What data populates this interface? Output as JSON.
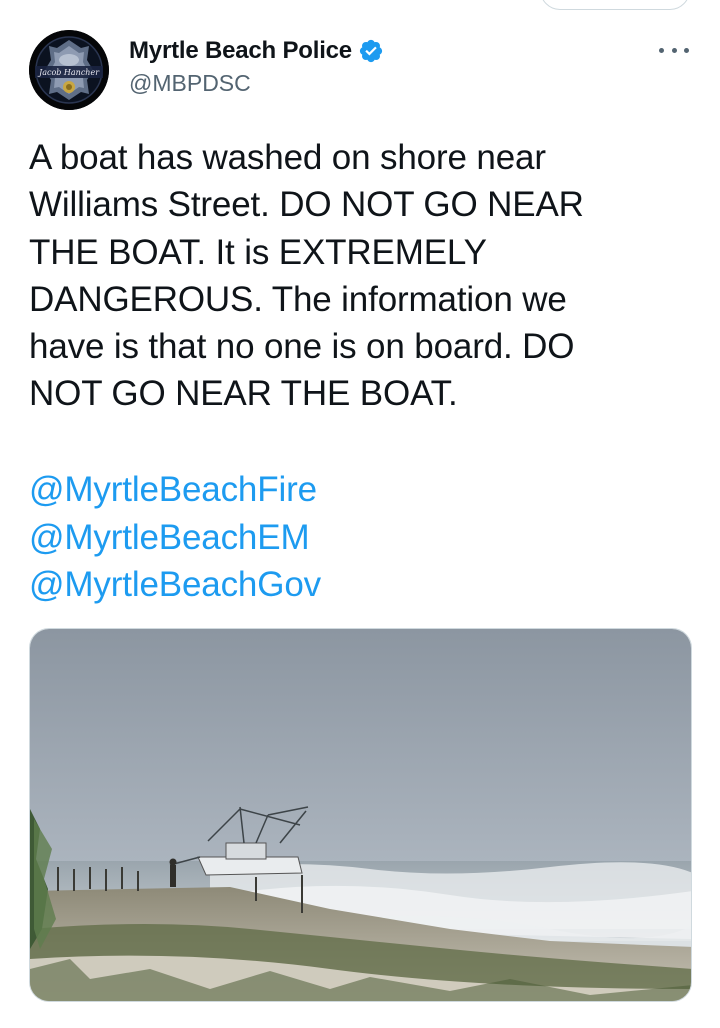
{
  "author": {
    "display_name": "Myrtle Beach Police",
    "handle": "@MBPDSC",
    "verified": true,
    "avatar_icon": "police-badge-icon"
  },
  "tweet": {
    "text": "A boat has washed on shore near\nWilliams Street. DO NOT GO NEAR\nTHE BOAT. It is EXTREMELY\nDANGEROUS. The information we\nhave is that no one is on board. DO\nNOT GO NEAR THE BOAT.",
    "mentions": [
      "@MyrtleBeachFire",
      "@MyrtleBeachEM",
      "@MyrtleBeachGov"
    ]
  },
  "media": {
    "alt_subject": "boat-washed-ashore-photo"
  },
  "colors": {
    "link": "#1d9bf0",
    "verified": "#1d9bf0",
    "secondary_text": "#536471",
    "border": "#cfd9de"
  }
}
